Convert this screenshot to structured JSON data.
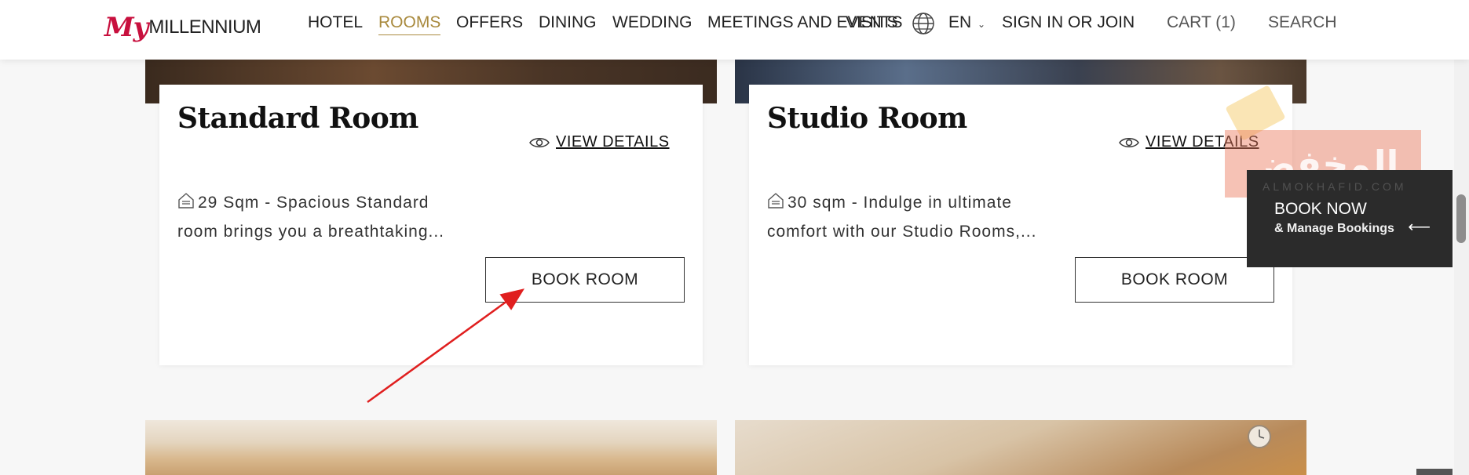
{
  "logo": {
    "my": "My",
    "brand": "MILLENNIUM"
  },
  "nav": {
    "items": [
      "HOTEL",
      "ROOMS",
      "OFFERS",
      "DINING",
      "WEDDING",
      "MEETINGS AND EVENTS",
      "VISITS"
    ],
    "active": "ROOMS",
    "language": "EN",
    "sign_in": "SIGN IN OR JOIN",
    "cart": "CART (1)",
    "search": "SEARCH"
  },
  "rooms": [
    {
      "title": "Standard Room",
      "view_details": "VIEW DETAILS",
      "desc_line1": "29 Sqm - Spacious Standard",
      "desc_line2": "room brings you a breathtaking...",
      "book_label": "BOOK ROOM"
    },
    {
      "title": "Studio Room",
      "view_details": "VIEW DETAILS",
      "desc_line1": "30 sqm - Indulge in ultimate",
      "desc_line2": "comfort with our Studio Rooms,...",
      "book_label": "BOOK ROOM"
    }
  ],
  "book_now": {
    "title": "BOOK NOW",
    "subtitle": "& Manage Bookings"
  },
  "watermark": {
    "arabic": "المخفض",
    "latin": "ALMOKHAFID.COM"
  },
  "colors": {
    "accent_gold": "#a98a3e",
    "logo_red": "#c8103e",
    "annotation_red": "#e01f1f"
  }
}
